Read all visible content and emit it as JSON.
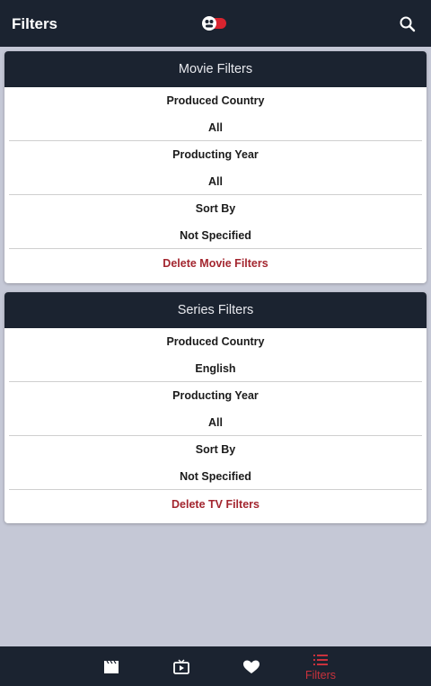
{
  "appbar": {
    "title": "Filters",
    "toggle_icon": "mascot-toggle-icon",
    "search_icon": "search-icon"
  },
  "colors": {
    "bar_bg": "#1b2330",
    "page_bg": "#c5c8d6",
    "accent": "#a3262f",
    "active_nav": "#c9323c"
  },
  "movie_filters": {
    "header": "Movie Filters",
    "produced_country_label": "Produced Country",
    "produced_country_value": "All",
    "producting_year_label": "Producting Year",
    "producting_year_value": "All",
    "sort_by_label": "Sort By",
    "sort_by_value": "Not Specified",
    "delete_label": "Delete Movie Filters"
  },
  "series_filters": {
    "header": "Series Filters",
    "produced_country_label": "Produced Country",
    "produced_country_value": "English",
    "producting_year_label": "Producting Year",
    "producting_year_value": "All",
    "sort_by_label": "Sort By",
    "sort_by_value": "Not Specified",
    "delete_label": "Delete TV Filters"
  },
  "bottom_nav": {
    "items": [
      {
        "icon": "clapperboard-icon"
      },
      {
        "icon": "tv-play-icon"
      },
      {
        "icon": "heart-icon"
      },
      {
        "icon": "list-icon",
        "label": "Filters",
        "active": true
      }
    ]
  }
}
